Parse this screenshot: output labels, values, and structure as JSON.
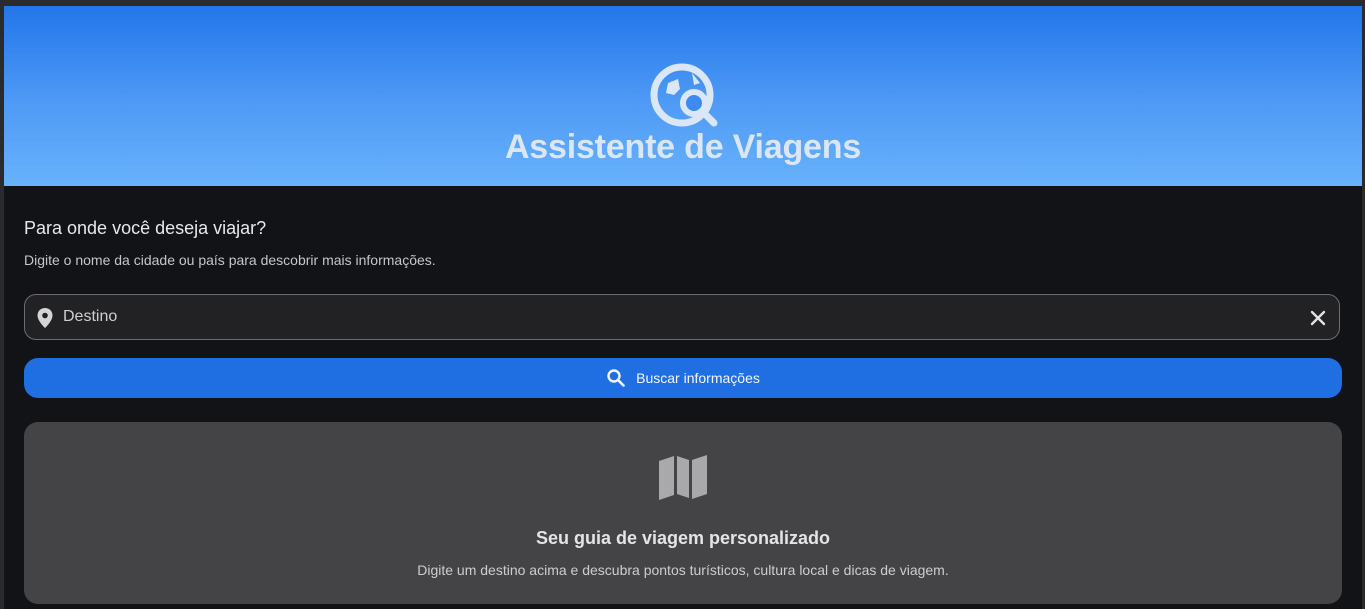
{
  "header": {
    "title": "Assistente de Viagens",
    "icon": "travel-explore-icon",
    "gradient_top": "#2376ea",
    "gradient_bottom": "#68b2fb"
  },
  "form": {
    "question": "Para onde você deseja viajar?",
    "hint": "Digite o nome da cidade ou país para descobrir mais informações.",
    "destination_placeholder": "Destino",
    "destination_value": "",
    "destination_icon": "location-pin-icon",
    "clear_icon": "close-icon",
    "search_button_label": "Buscar informações",
    "search_button_icon": "search-icon",
    "accent": "#1f6fe3"
  },
  "empty_state": {
    "icon": "map-icon",
    "title": "Seu guia de viagem personalizado",
    "text": "Digite um destino acima e descubra pontos turísticos, cultura local e dicas de viagem."
  }
}
